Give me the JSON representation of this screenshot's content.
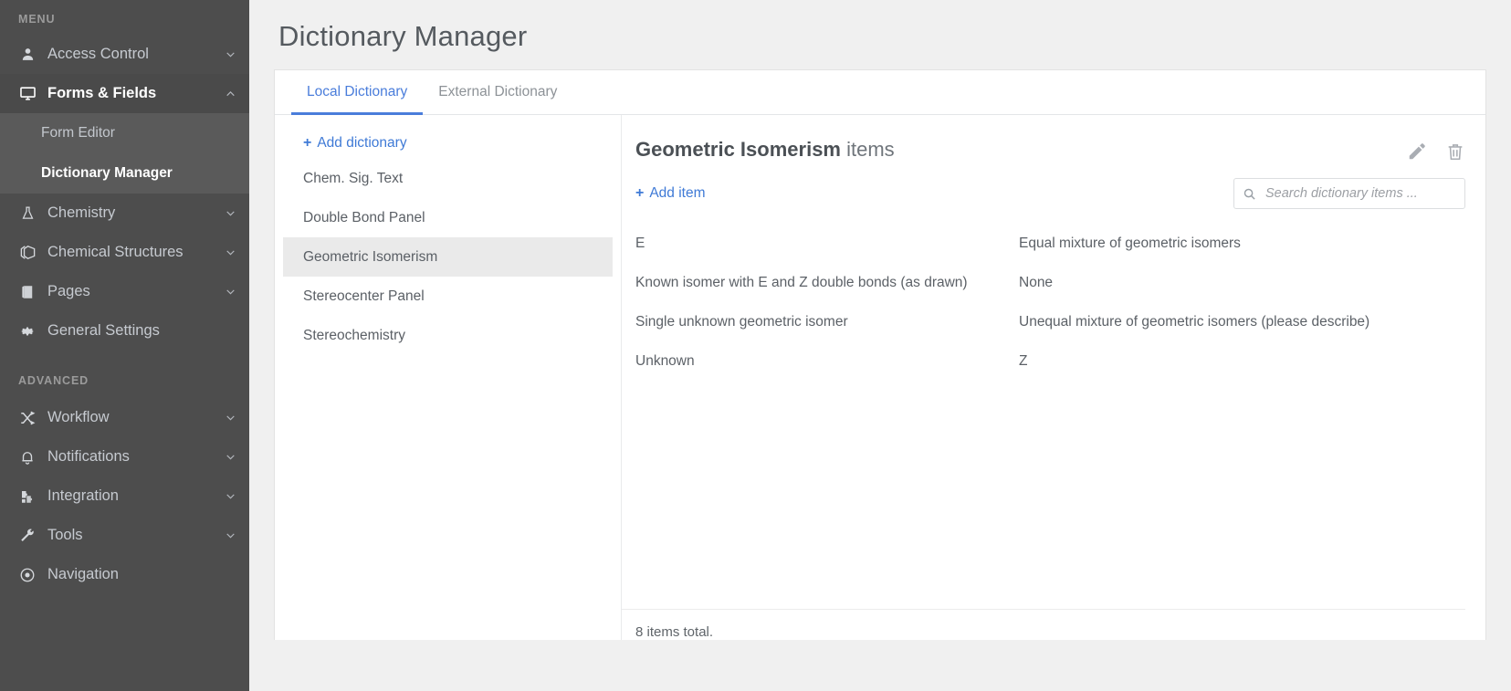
{
  "sidebar": {
    "menu_label": "MENU",
    "advanced_label": "ADVANCED",
    "menu_items": [
      {
        "label": "Access Control",
        "icon": "user-icon",
        "chevron": "down",
        "state": "collapsed"
      },
      {
        "label": "Forms & Fields",
        "icon": "monitor-icon",
        "chevron": "up",
        "state": "expanded"
      },
      {
        "label": "Chemistry",
        "icon": "flask-icon",
        "chevron": "down",
        "state": "collapsed"
      },
      {
        "label": "Chemical Structures",
        "icon": "hexagon-icon",
        "chevron": "down",
        "state": "collapsed"
      },
      {
        "label": "Pages",
        "icon": "book-icon",
        "chevron": "down",
        "state": "collapsed"
      },
      {
        "label": "General Settings",
        "icon": "gear-icon",
        "chevron": "none",
        "state": "none"
      }
    ],
    "sub_items": [
      {
        "label": "Form Editor",
        "active": false
      },
      {
        "label": "Dictionary Manager",
        "active": true
      }
    ],
    "advanced_items": [
      {
        "label": "Workflow",
        "icon": "shuffle-icon",
        "chevron": "down"
      },
      {
        "label": "Notifications",
        "icon": "bell-icon",
        "chevron": "down"
      },
      {
        "label": "Integration",
        "icon": "puzzle-icon",
        "chevron": "down"
      },
      {
        "label": "Tools",
        "icon": "wrench-icon",
        "chevron": "down"
      },
      {
        "label": "Navigation",
        "icon": "compass-icon",
        "chevron": "none"
      }
    ]
  },
  "header": {
    "title": "Dictionary Manager"
  },
  "tabs": [
    {
      "label": "Local Dictionary",
      "active": true
    },
    {
      "label": "External Dictionary",
      "active": false
    }
  ],
  "dictionary_panel": {
    "add_label": "Add dictionary",
    "add_plus": "+",
    "items": [
      {
        "label": "Chem. Sig. Text",
        "selected": false
      },
      {
        "label": "Double Bond Panel",
        "selected": false
      },
      {
        "label": "Geometric Isomerism",
        "selected": true
      },
      {
        "label": "Stereocenter Panel",
        "selected": false
      },
      {
        "label": "Stereochemistry",
        "selected": false
      }
    ]
  },
  "detail_panel": {
    "title_bold": "Geometric Isomerism",
    "title_light": "items",
    "edit_icon": "pencil-icon",
    "delete_icon": "trash-icon",
    "add_item_label": "Add item",
    "add_item_plus": "+",
    "search": {
      "placeholder": "Search dictionary items ...",
      "value": "",
      "icon": "search-icon"
    },
    "rows": [
      {
        "left": "E",
        "right": "Equal mixture of geometric isomers"
      },
      {
        "left": "Known isomer with E and Z double bonds (as drawn)",
        "right": "None"
      },
      {
        "left": "Single unknown geometric isomer",
        "right": "Unequal mixture of geometric isomers (please describe)"
      },
      {
        "left": "Unknown",
        "right": "Z"
      }
    ],
    "footer_total": "8 items total."
  },
  "colors": {
    "sidebar_bg": "#4d4d4d",
    "sidebar_sub_bg": "#5a5a5a",
    "accent_blue": "#4a7ddb",
    "link_blue": "#3f7ad6",
    "selected_row": "#eaeaea",
    "page_bg": "#f0f0f0",
    "card_bg": "#ffffff",
    "text_primary": "#5c6167"
  }
}
